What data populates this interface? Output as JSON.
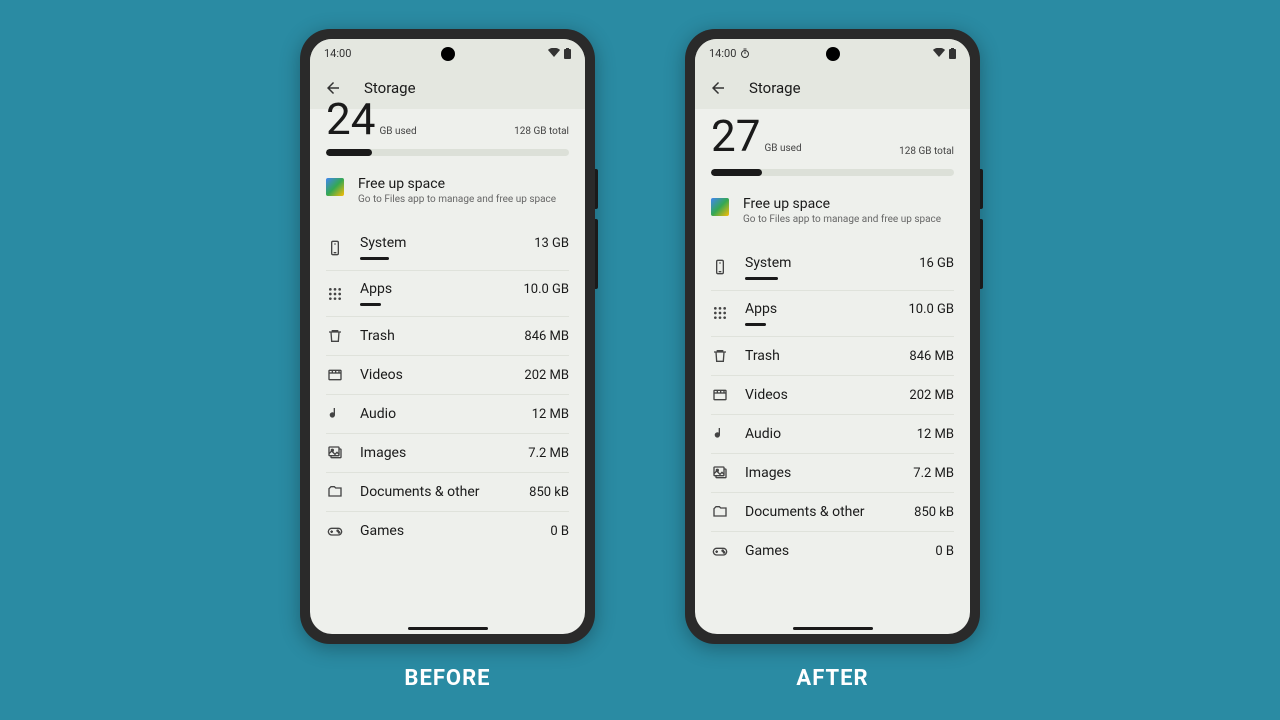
{
  "captions": {
    "before": "BEFORE",
    "after": "AFTER"
  },
  "status": {
    "time": "14:00"
  },
  "header": {
    "title": "Storage"
  },
  "summary": {
    "before": {
      "used_num": "24",
      "used_label": "GB used",
      "total": "128 GB total",
      "progress_pct": 19
    },
    "after": {
      "used_num": "27",
      "used_label": "GB used",
      "total": "128 GB total",
      "progress_pct": 21
    }
  },
  "free_up": {
    "title": "Free up space",
    "desc": "Go to Files app to manage and free up space"
  },
  "categories": {
    "before": [
      {
        "icon": "system",
        "name": "System",
        "size": "13 GB",
        "bar": 14
      },
      {
        "icon": "apps",
        "name": "Apps",
        "size": "10.0 GB",
        "bar": 10
      },
      {
        "icon": "trash",
        "name": "Trash",
        "size": "846 MB",
        "bar": 0
      },
      {
        "icon": "videos",
        "name": "Videos",
        "size": "202 MB",
        "bar": 0
      },
      {
        "icon": "audio",
        "name": "Audio",
        "size": "12 MB",
        "bar": 0
      },
      {
        "icon": "images",
        "name": "Images",
        "size": "7.2 MB",
        "bar": 0
      },
      {
        "icon": "docs",
        "name": "Documents & other",
        "size": "850 kB",
        "bar": 0
      },
      {
        "icon": "games",
        "name": "Games",
        "size": "0 B",
        "bar": 0
      }
    ],
    "after": [
      {
        "icon": "system",
        "name": "System",
        "size": "16 GB",
        "bar": 16
      },
      {
        "icon": "apps",
        "name": "Apps",
        "size": "10.0 GB",
        "bar": 10
      },
      {
        "icon": "trash",
        "name": "Trash",
        "size": "846 MB",
        "bar": 0
      },
      {
        "icon": "videos",
        "name": "Videos",
        "size": "202 MB",
        "bar": 0
      },
      {
        "icon": "audio",
        "name": "Audio",
        "size": "12 MB",
        "bar": 0
      },
      {
        "icon": "images",
        "name": "Images",
        "size": "7.2 MB",
        "bar": 0
      },
      {
        "icon": "docs",
        "name": "Documents & other",
        "size": "850 kB",
        "bar": 0
      },
      {
        "icon": "games",
        "name": "Games",
        "size": "0 B",
        "bar": 0
      }
    ]
  }
}
